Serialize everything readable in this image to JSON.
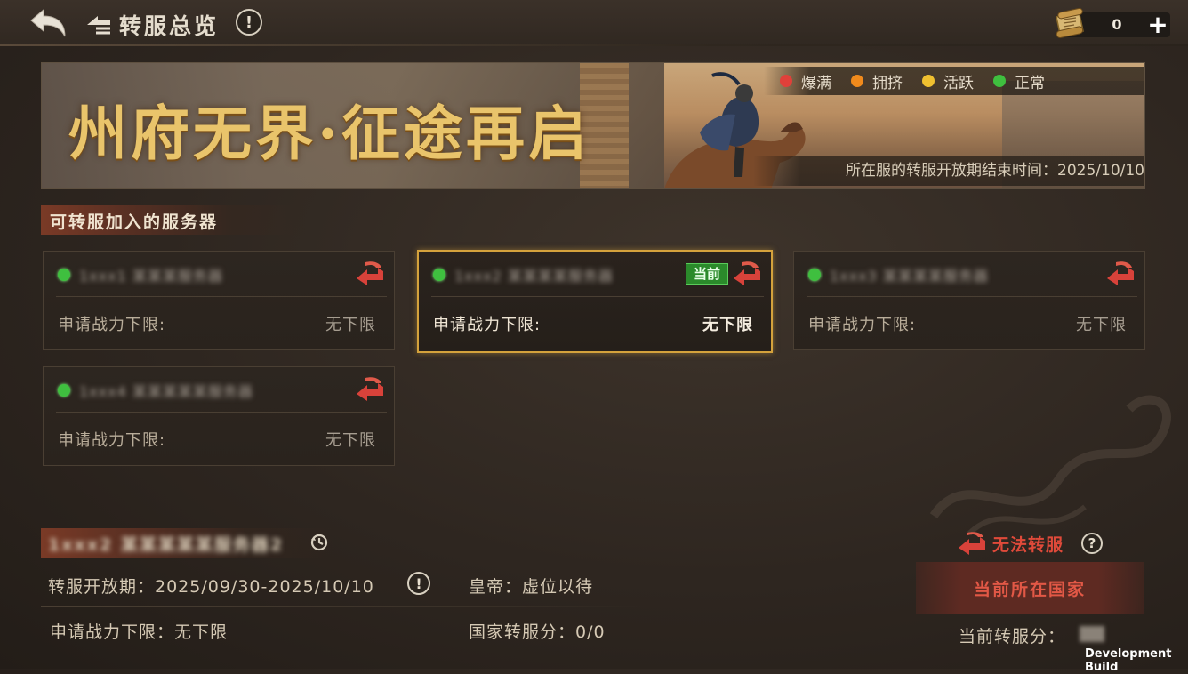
{
  "header": {
    "title": "转服总览",
    "info_glyph": "!",
    "currency_count": "0",
    "plus_glyph": "+"
  },
  "banner": {
    "title": "州府无界·征途再启",
    "legend": [
      {
        "label": "爆满",
        "color": "#e0403a"
      },
      {
        "label": "拥挤",
        "color": "#f08a1c"
      },
      {
        "label": "活跃",
        "color": "#f0c030"
      },
      {
        "label": "正常",
        "color": "#3fbf3f"
      }
    ],
    "end_time": "所在服的转服开放期结束时间：2025/10/10"
  },
  "servers_section": {
    "title": "可转服加入的服务器",
    "cards": [
      {
        "name": "1xxx1 某某某服务器",
        "label": "申请战力下限:",
        "value": "无下限",
        "current": false
      },
      {
        "name": "1xxx2 某某某某服务器",
        "label": "申请战力下限:",
        "value": "无下限",
        "current": true,
        "badge": "当前"
      },
      {
        "name": "1xxx3 某某某某服务器",
        "label": "申请战力下限:",
        "value": "无下限",
        "current": false
      },
      {
        "name": "1xxx4 某某某某某服务器",
        "label": "申请战力下限:",
        "value": "无下限",
        "current": false
      }
    ]
  },
  "current_server": {
    "name": "1xxx2 某某某某某服务器2",
    "transfer_period": "转服开放期：2025/09/30-2025/10/10",
    "emperor": "皇帝：虚位以待",
    "power_limit": "申请战力下限：无下限",
    "country_score": "国家转服分：0/0"
  },
  "side_panel": {
    "cannot_transfer": "无法转服",
    "help_glyph": "?",
    "current_country_button": "当前所在国家",
    "transfer_score_label": "当前转服分："
  },
  "watermark": "Development Build"
}
